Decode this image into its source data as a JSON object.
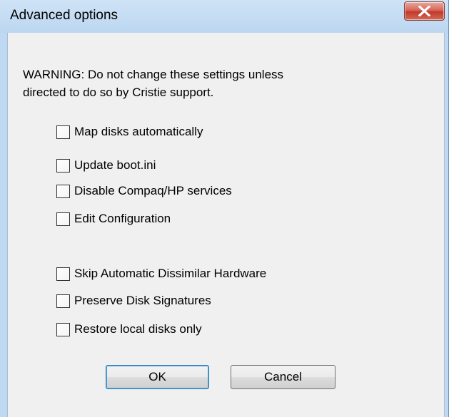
{
  "window": {
    "title": "Advanced options"
  },
  "warning": {
    "line1": "WARNING: Do not change these settings unless",
    "line2": "directed to do so by Cristie support."
  },
  "options_group1": [
    {
      "label": "Map disks automatically",
      "checked": false
    },
    {
      "label": "Update boot.ini",
      "checked": false
    },
    {
      "label": "Disable Compaq/HP services",
      "checked": false
    },
    {
      "label": "Edit Configuration",
      "checked": false
    }
  ],
  "options_group2": [
    {
      "label": "Skip Automatic Dissimilar Hardware",
      "checked": false
    },
    {
      "label": "Preserve Disk Signatures",
      "checked": false
    },
    {
      "label": "Restore local disks only",
      "checked": false
    }
  ],
  "buttons": {
    "ok": "OK",
    "cancel": "Cancel"
  },
  "icons": {
    "close": "close-icon"
  },
  "colors": {
    "close_button": "#c94a3c",
    "default_button_border": "#3c7fb1",
    "dialog_background": "#f0f0f0",
    "frame": "#bfd9f2"
  }
}
